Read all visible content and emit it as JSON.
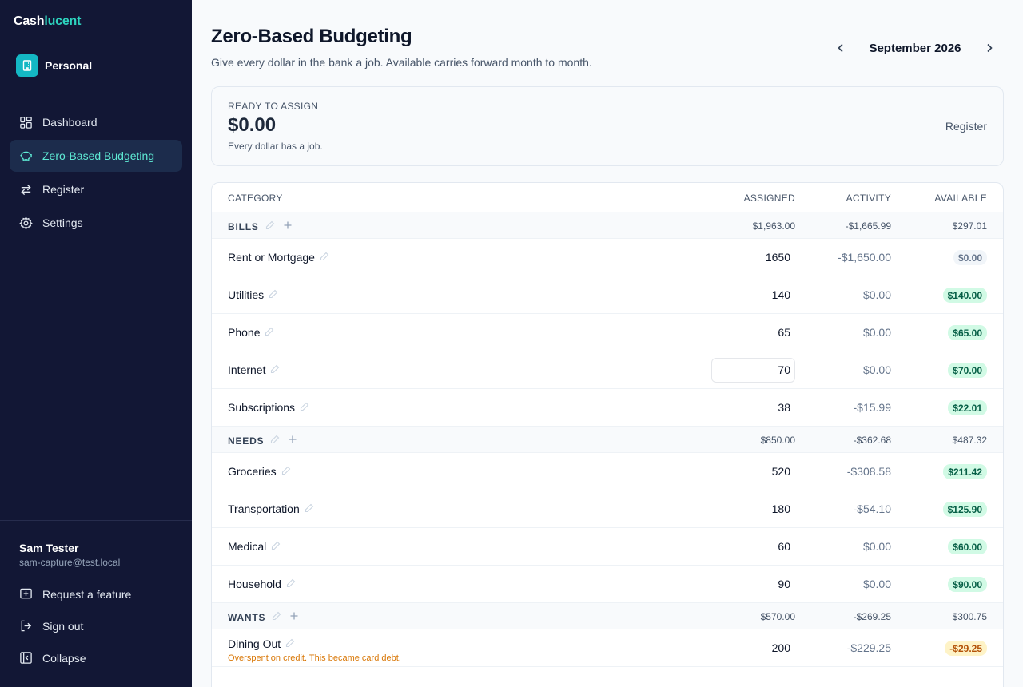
{
  "brand": {
    "part1": "Cash",
    "part2": "lucent"
  },
  "workspace": {
    "label": "Personal"
  },
  "nav": [
    {
      "label": "Dashboard",
      "icon": "grid-icon",
      "active": false
    },
    {
      "label": "Zero-Based Budgeting",
      "icon": "piggy-bank-icon",
      "active": true
    },
    {
      "label": "Register",
      "icon": "arrows-swap-icon",
      "active": false
    },
    {
      "label": "Settings",
      "icon": "gear-icon",
      "active": false
    }
  ],
  "user": {
    "name": "Sam Tester",
    "email": "sam-capture@test.local"
  },
  "footer": {
    "request": "Request a feature",
    "signout": "Sign out",
    "collapse": "Collapse"
  },
  "page": {
    "title": "Zero-Based Budgeting",
    "subtitle": "Give every dollar in the bank a job. Available carries forward month to month.",
    "month": "September 2026"
  },
  "ready_to_assign": {
    "label": "READY TO ASSIGN",
    "amount": "$0.00",
    "note": "Every dollar has a job.",
    "link": "Register"
  },
  "table": {
    "headers": {
      "category": "CATEGORY",
      "assigned": "ASSIGNED",
      "activity": "ACTIVITY",
      "available": "AVAILABLE"
    },
    "groups": [
      {
        "name": "BILLS",
        "assigned": "$1,963.00",
        "activity": "-$1,665.99",
        "available": "$297.01",
        "categories": [
          {
            "name": "Rent or Mortgage",
            "assigned": "1650",
            "activity": "-$1,650.00",
            "available": "$0.00",
            "status": "zero"
          },
          {
            "name": "Utilities",
            "assigned": "140",
            "activity": "$0.00",
            "available": "$140.00",
            "status": "pos"
          },
          {
            "name": "Phone",
            "assigned": "65",
            "activity": "$0.00",
            "available": "$65.00",
            "status": "pos"
          },
          {
            "name": "Internet",
            "assigned": "70",
            "activity": "$0.00",
            "available": "$70.00",
            "status": "pos",
            "focused": true
          },
          {
            "name": "Subscriptions",
            "assigned": "38",
            "activity": "-$15.99",
            "available": "$22.01",
            "status": "pos"
          }
        ]
      },
      {
        "name": "NEEDS",
        "assigned": "$850.00",
        "activity": "-$362.68",
        "available": "$487.32",
        "categories": [
          {
            "name": "Groceries",
            "assigned": "520",
            "activity": "-$308.58",
            "available": "$211.42",
            "status": "pos"
          },
          {
            "name": "Transportation",
            "assigned": "180",
            "activity": "-$54.10",
            "available": "$125.90",
            "status": "pos"
          },
          {
            "name": "Medical",
            "assigned": "60",
            "activity": "$0.00",
            "available": "$60.00",
            "status": "pos"
          },
          {
            "name": "Household",
            "assigned": "90",
            "activity": "$0.00",
            "available": "$90.00",
            "status": "pos"
          }
        ]
      },
      {
        "name": "WANTS",
        "assigned": "$570.00",
        "activity": "-$269.25",
        "available": "$300.75",
        "categories": [
          {
            "name": "Dining Out",
            "assigned": "200",
            "activity": "-$229.25",
            "available": "-$29.25",
            "status": "neg",
            "warning": "Overspent on credit. This became card debt."
          }
        ]
      }
    ]
  },
  "colors": {
    "sidebar": "#121735",
    "accent": "#2dd4bf",
    "positive_bg": "#d1fae5",
    "negative_bg": "#fef3c7",
    "warning_text": "#d97706"
  }
}
